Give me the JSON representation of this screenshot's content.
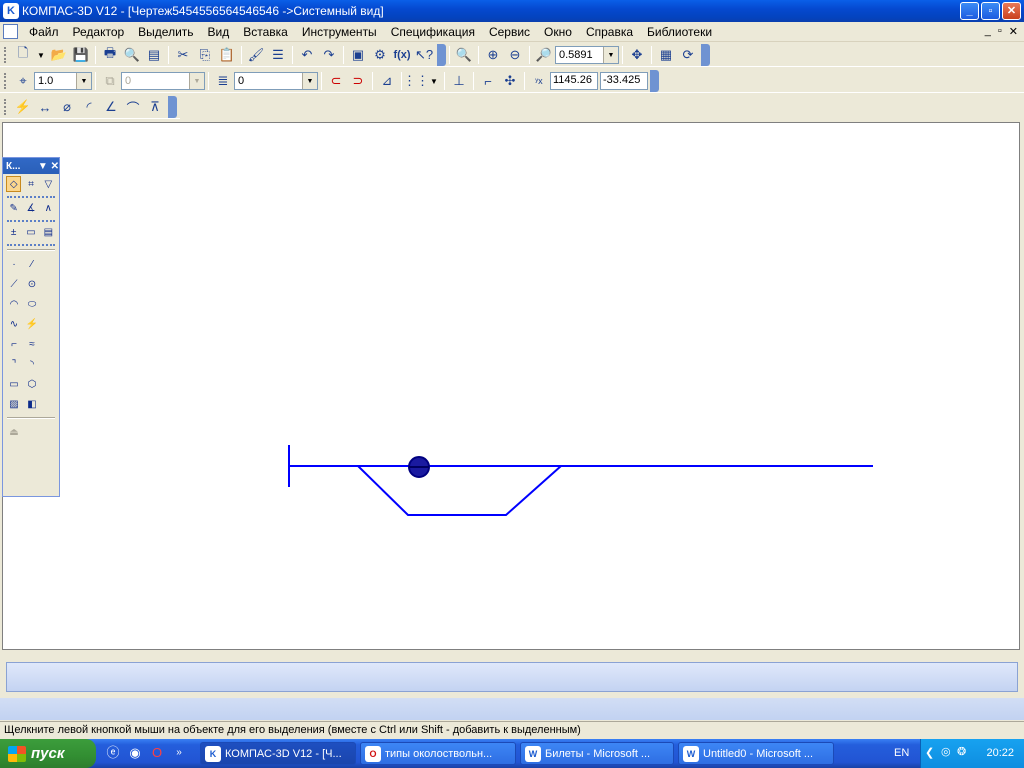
{
  "window": {
    "title": "КОМПАС-3D V12 - [Чертеж5454556564546546 ->Системный вид]",
    "app_icon": "K"
  },
  "menu": [
    "Файл",
    "Редактор",
    "Выделить",
    "Вид",
    "Вставка",
    "Инструменты",
    "Спецификация",
    "Сервис",
    "Окно",
    "Справка",
    "Библиотеки"
  ],
  "toolbar1": {
    "zoom_value": "0.5891"
  },
  "toolbar2": {
    "linestyle_value": "1.0",
    "layer_state_value": "0",
    "layer_value": "0",
    "coord_x": "1145.26",
    "coord_y": "-33.425"
  },
  "compact_panel": {
    "title": "К..."
  },
  "status": {
    "hint": "Щелкните левой кнопкой мыши на объекте для его выделения (вместе с Ctrl или Shift - добавить к выделенным)"
  },
  "taskbar": {
    "start_label": "пуск",
    "tasks": [
      "КОМПАС-3D V12 - [Ч...",
      "типы околоствольн...",
      "Билеты - Microsoft ...",
      "Untitled0 - Microsoft ..."
    ],
    "language": "EN",
    "clock": "20:22"
  },
  "drawing": {
    "line_color": "#0000ff"
  }
}
